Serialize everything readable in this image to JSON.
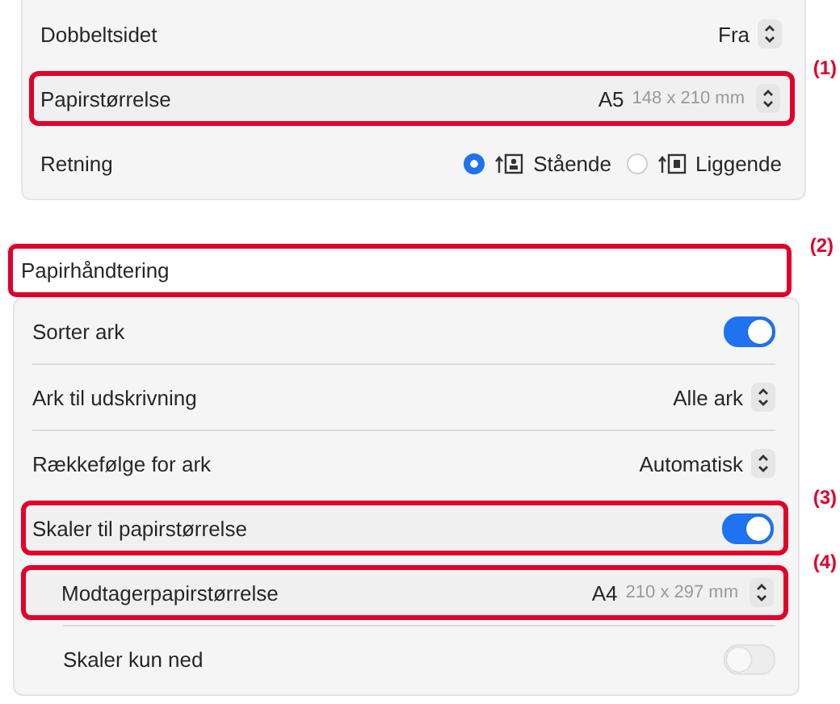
{
  "sections": [
    {
      "rows": [
        {
          "kind": "popup",
          "label": "Dobbeltsidet",
          "value": "Fra",
          "highlighted": false,
          "indented": false
        },
        {
          "kind": "popup",
          "label": "Papirstørrelse",
          "value": "A5",
          "detail": "148 x 210 mm",
          "highlighted": true,
          "indented": false,
          "callout": "(1)"
        },
        {
          "kind": "radio",
          "label": "Retning",
          "highlighted": false,
          "indented": false,
          "options": [
            {
              "label": "Stående",
              "selected": true
            },
            {
              "label": "Liggende",
              "selected": false
            }
          ]
        }
      ]
    },
    {
      "title": "Papirhåndtering",
      "title_highlighted": true,
      "title_callout": "(2)",
      "rows": [
        {
          "kind": "toggle",
          "label": "Sorter ark",
          "on": true,
          "disabled": false,
          "highlighted": false,
          "indented": false
        },
        {
          "kind": "popup",
          "label": "Ark til udskrivning",
          "value": "Alle ark",
          "highlighted": false,
          "indented": false
        },
        {
          "kind": "popup",
          "label": "Rækkefølge for ark",
          "value": "Automatisk",
          "highlighted": false,
          "indented": false
        },
        {
          "kind": "toggle",
          "label": "Skaler til papirstørrelse",
          "on": true,
          "disabled": false,
          "highlighted": true,
          "indented": false,
          "callout": "(3)"
        },
        {
          "kind": "popup",
          "label": "Modtagerpapirstørrelse",
          "value": "A4",
          "detail": "210 x 297 mm",
          "highlighted": true,
          "indented": true,
          "callout": "(4)"
        },
        {
          "kind": "toggle",
          "label": "Skaler kun ned",
          "on": false,
          "disabled": true,
          "highlighted": false,
          "indented": true
        }
      ]
    }
  ]
}
